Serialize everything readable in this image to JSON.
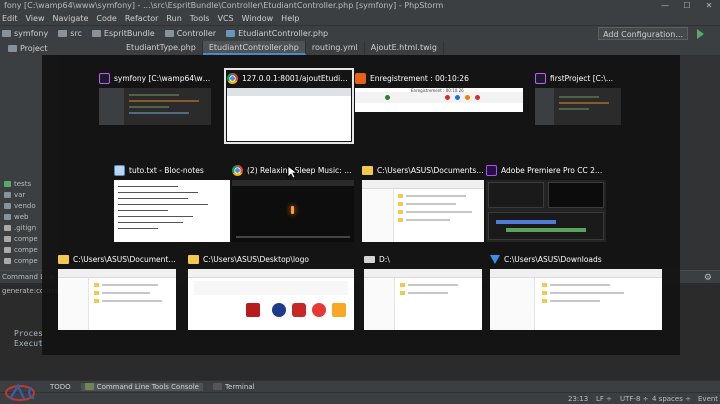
{
  "window": {
    "title": "fony [C:\\wamp64\\www\\symfony] - ...\\src\\EspritBundle\\Controller\\EtudiantController.php [symfony] - PhpStorm",
    "controls": [
      "—",
      "☐",
      "✕"
    ]
  },
  "menu": [
    "Edit",
    "View",
    "Navigate",
    "Code",
    "Refactor",
    "Run",
    "Tools",
    "VCS",
    "Window",
    "Help"
  ],
  "navbar": {
    "crumbs": [
      "symfony",
      "src",
      "EspritBundle",
      "Controller",
      "EtudiantController.php"
    ],
    "add_configuration": "Add Configuration..."
  },
  "tabs": {
    "project_label": "Project",
    "items": [
      {
        "label": "EtudiantType.php",
        "active": false
      },
      {
        "label": "EtudiantController.php",
        "active": true
      },
      {
        "label": "routing.yml",
        "active": false
      },
      {
        "label": "AjoutE.html.twig",
        "active": false
      }
    ]
  },
  "tree": [
    "tests",
    "var",
    "vendo",
    "web",
    ".gitign",
    "compe",
    "compe",
    "compe"
  ],
  "console": {
    "head": "Command Line",
    "cmd": "generate:controller",
    "lines": [
      "Proces",
      "Execut"
    ]
  },
  "toolwindows": [
    {
      "label": "TODO",
      "active": false
    },
    {
      "label": "Command Line Tools Console",
      "active": true
    },
    {
      "label": "Terminal",
      "active": false
    }
  ],
  "status": {
    "position": "23:13",
    "line_sep": "LF ÷",
    "encoding": "UTF-8 ÷",
    "indent": "4 spaces ÷",
    "event_log": "Event Lo"
  },
  "switcher": {
    "rows": [
      [
        {
          "title": "symfony [C:\\wamp64\\www\\...",
          "icon": "phpstorm-icon",
          "body": "ide"
        },
        {
          "title": "127.0.0.1:8001/ajoutEtudian...",
          "icon": "chrome-icon",
          "body": "chrome",
          "selected": true
        },
        {
          "title": "Enregistrement : 00:10:26",
          "icon": "recorder-icon",
          "body": "recorder",
          "body_text": "Enregistrement : 00:10:26"
        },
        {
          "title": "firstProject [C:\\...",
          "icon": "phpstorm-icon",
          "body": "ide"
        }
      ],
      [
        {
          "title": "tuto.txt - Bloc-notes",
          "icon": "notepad-icon",
          "body": "notepad"
        },
        {
          "title": "(2) Relaxing Sleep Music: D...",
          "icon": "chrome-icon",
          "body": "video"
        },
        {
          "title": "C:\\Users\\ASUS\\Documents\\...",
          "icon": "folder-icon",
          "body": "explorer"
        },
        {
          "title": "Adobe Premiere Pro CC 201...",
          "icon": "premiere-icon",
          "body": "premiere"
        }
      ],
      [
        {
          "title": "C:\\Users\\ASUS\\Documents\\...",
          "icon": "folder-icon",
          "body": "explorer"
        },
        {
          "title": "C:\\Users\\ASUS\\Desktop\\logo",
          "icon": "folder-icon",
          "body": "logo"
        },
        {
          "title": "D:\\",
          "icon": "drive-icon",
          "body": "explorer"
        },
        {
          "title": "C:\\Users\\ASUS\\Downloads",
          "icon": "download-icon",
          "body": "explorer"
        }
      ]
    ]
  }
}
